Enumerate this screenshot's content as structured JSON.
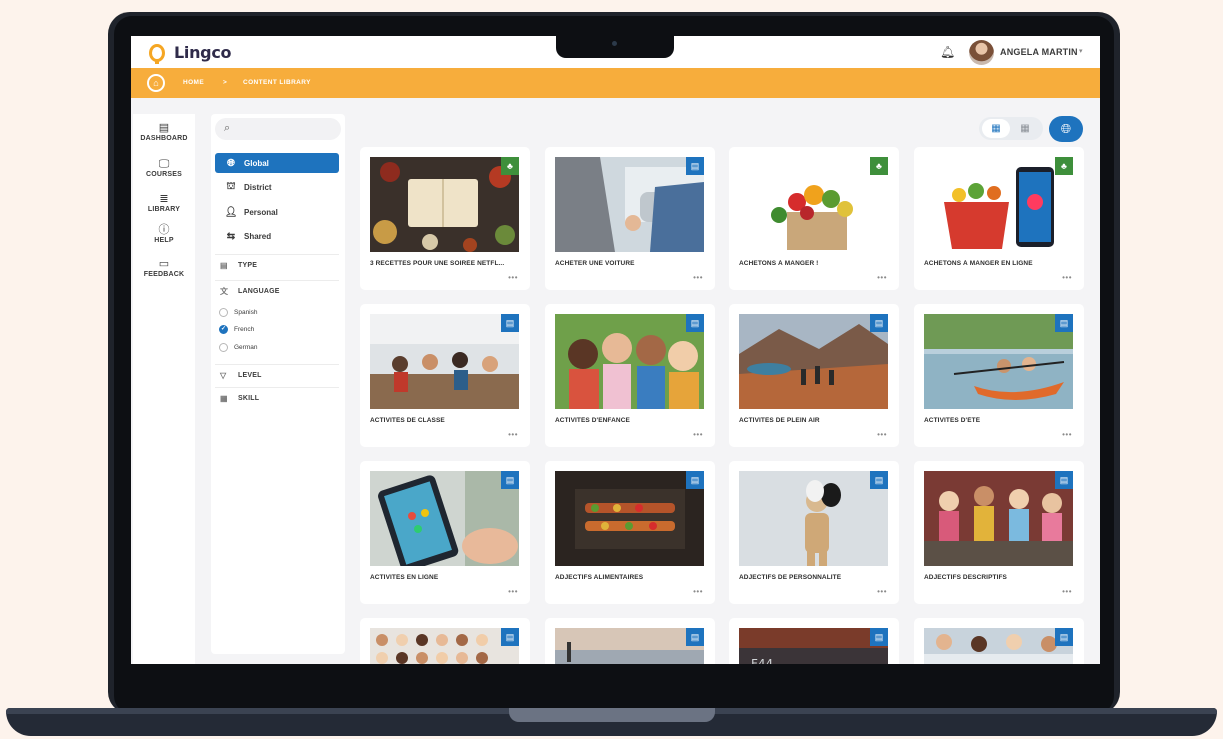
{
  "app": {
    "name": "Lingco"
  },
  "header": {
    "user_name": "ANGELA MARTIN",
    "caret": "▾"
  },
  "breadcrumb": [
    "HOME",
    ">",
    "CONTENT LIBRARY"
  ],
  "left_nav": [
    {
      "label": "DASHBOARD",
      "icon": "dashboard-icon",
      "glyph": "▤"
    },
    {
      "label": "COURSES",
      "icon": "courses-icon",
      "glyph": "🖵"
    },
    {
      "label": "LIBRARY",
      "icon": "library-icon",
      "glyph": "≣"
    },
    {
      "label": "HELP",
      "icon": "help-icon",
      "glyph": "ⓘ"
    },
    {
      "label": "FEEDBACK",
      "icon": "feedback-icon",
      "glyph": "▭"
    }
  ],
  "filters": {
    "search_placeholder": "",
    "scopes": [
      {
        "label": "Global",
        "active": true
      },
      {
        "label": "District",
        "active": false
      },
      {
        "label": "Personal",
        "active": false
      },
      {
        "label": "Shared",
        "active": false
      }
    ],
    "type_label": "TYPE",
    "language_label": "LANGUAGE",
    "languages": [
      {
        "label": "Spanish",
        "checked": false
      },
      {
        "label": "French",
        "checked": true
      },
      {
        "label": "German",
        "checked": false
      }
    ],
    "level_label": "LEVEL",
    "skill_label": "SKILL"
  },
  "cards": [
    {
      "title": "3 RECETTES POUR UNE SOIRÉE NETFL...",
      "badge": "green"
    },
    {
      "title": "ACHETER UNE VOITURE",
      "badge": "blue"
    },
    {
      "title": "ACHETONS À MANGER !",
      "badge": "green"
    },
    {
      "title": "ACHETONS À MANGER EN LIGNE",
      "badge": "green"
    },
    {
      "title": "ACTIVITÉS DE CLASSE",
      "badge": "blue"
    },
    {
      "title": "ACTIVITÉS D'ENFANCE",
      "badge": "blue"
    },
    {
      "title": "ACTIVITÉS DE PLEIN AIR",
      "badge": "blue"
    },
    {
      "title": "ACTIVITÉS D'ÉTÉ",
      "badge": "blue"
    },
    {
      "title": "ACTIVITÉS EN LIGNE",
      "badge": "blue"
    },
    {
      "title": "ADJECTIFS ALIMENTAIRES",
      "badge": "blue"
    },
    {
      "title": "ADJECTIFS DE PERSONNALITÉ",
      "badge": "blue"
    },
    {
      "title": "ADJECTIFS DESCRIPTIFS",
      "badge": "blue"
    },
    {
      "title": "",
      "badge": "blue"
    },
    {
      "title": "",
      "badge": "blue"
    },
    {
      "title": "",
      "badge": "blue"
    },
    {
      "title": "",
      "badge": "blue"
    }
  ],
  "more_label": "•••",
  "colors": {
    "accent_blue": "#1e73be",
    "brand_orange": "#f7ad3c",
    "badge_green": "#3e8f3b"
  }
}
